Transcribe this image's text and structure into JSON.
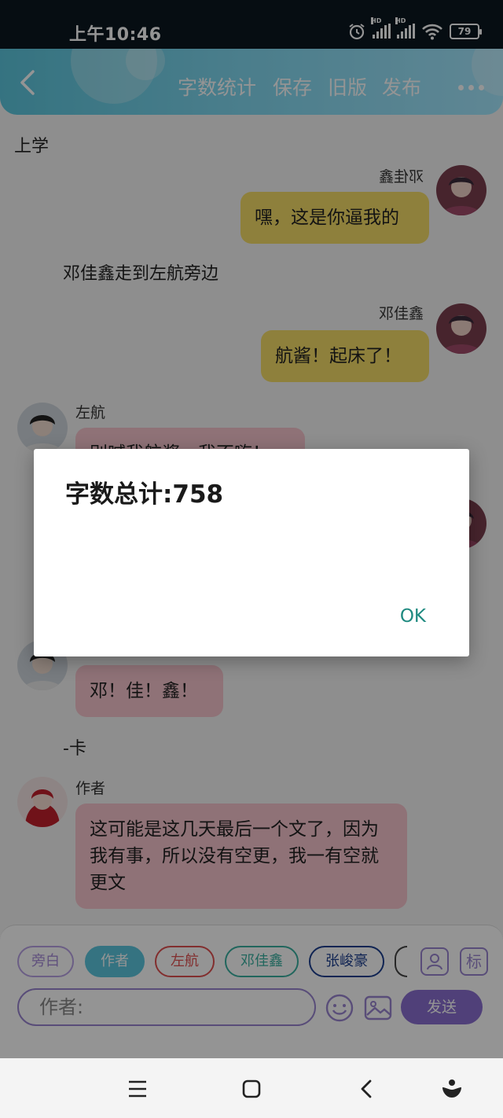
{
  "status": {
    "time": "上午10:46",
    "battery": "79",
    "hd": "HD"
  },
  "appbar": {
    "menu": [
      "字数统计",
      "保存",
      "旧版",
      "发布"
    ]
  },
  "chat": {
    "narrations": [
      "上学",
      "邓佳鑫走到左航旁边",
      "-卡"
    ],
    "messages": [
      {
        "sender": "邓佳鑫",
        "sender_mirrored": "邓佳鑫",
        "text": "嘿，这是你逼我的"
      },
      {
        "sender": "邓佳鑫",
        "text": "航酱！起床了！"
      },
      {
        "sender": "左航",
        "text": "别喊我航酱，我不嗨！"
      },
      {
        "text": "邓！佳！鑫！"
      },
      {
        "sender": "作者",
        "text": "这可能是这几天最后一个文了，因为我有事，所以没有空更，我一有空就更文"
      }
    ]
  },
  "bottom": {
    "chips": [
      "旁白",
      "作者",
      "左航",
      "邓佳鑫",
      "张峻豪"
    ],
    "square_buttons": [
      "标"
    ],
    "input_placeholder": "作者:",
    "send": "发送"
  },
  "dialog": {
    "title": "字数总计:758",
    "ok": "OK"
  },
  "colors": {
    "accent": "#8a6fd0",
    "ok": "#1f8a80",
    "yellow_bubble": "#f5dc68",
    "pink_bubble": "#f6c5cd"
  },
  "icons": [
    "alarm-icon",
    "signal-icon",
    "wifi-icon",
    "battery-icon",
    "back-arrow-icon",
    "more-icon",
    "person-card-icon",
    "emoji-icon",
    "image-icon",
    "menu-icon",
    "home-icon",
    "nav-back-icon",
    "assistant-icon"
  ]
}
